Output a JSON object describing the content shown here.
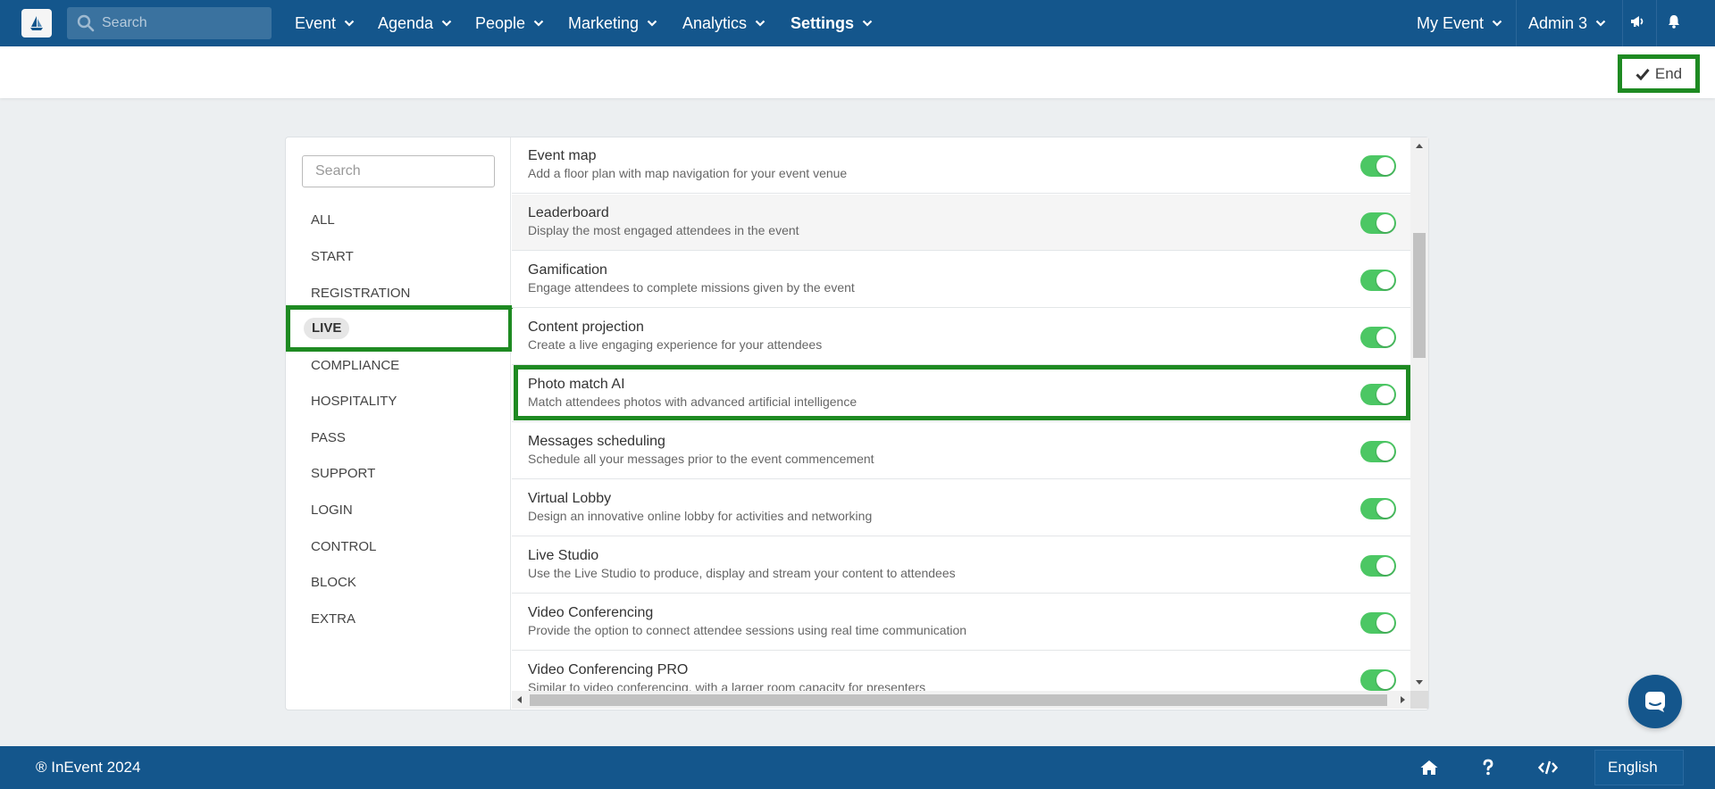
{
  "topnav": {
    "search_placeholder": "Search",
    "menu": [
      {
        "label": "Event"
      },
      {
        "label": "Agenda"
      },
      {
        "label": "People"
      },
      {
        "label": "Marketing"
      },
      {
        "label": "Analytics"
      },
      {
        "label": "Settings"
      }
    ],
    "event_selector": "My Event",
    "user_menu": "Admin 3"
  },
  "subbar": {
    "end_button": "End"
  },
  "tools": {
    "search_placeholder": "Search",
    "categories": [
      {
        "label": "ALL"
      },
      {
        "label": "START"
      },
      {
        "label": "REGISTRATION"
      },
      {
        "label": "LIVE",
        "active": true
      },
      {
        "label": "COMPLIANCE"
      },
      {
        "label": "HOSPITALITY"
      },
      {
        "label": "PASS"
      },
      {
        "label": "SUPPORT"
      },
      {
        "label": "LOGIN"
      },
      {
        "label": "CONTROL"
      },
      {
        "label": "BLOCK"
      },
      {
        "label": "EXTRA"
      }
    ],
    "features": [
      {
        "title": "Event map",
        "description": "Add a floor plan with map navigation for your event venue",
        "enabled": true
      },
      {
        "title": "Leaderboard",
        "description": "Display the most engaged attendees in the event",
        "enabled": true
      },
      {
        "title": "Gamification",
        "description": "Engage attendees to complete missions given by the event",
        "enabled": true
      },
      {
        "title": "Content projection",
        "description": "Create a live engaging experience for your attendees",
        "enabled": true
      },
      {
        "title": "Photo match AI",
        "description": "Match attendees photos with advanced artificial intelligence",
        "enabled": true
      },
      {
        "title": "Messages scheduling",
        "description": "Schedule all your messages prior to the event commencement",
        "enabled": true
      },
      {
        "title": "Virtual Lobby",
        "description": "Design an innovative online lobby for activities and networking",
        "enabled": true
      },
      {
        "title": "Live Studio",
        "description": "Use the Live Studio to produce, display and stream your content to attendees",
        "enabled": true
      },
      {
        "title": "Video Conferencing",
        "description": "Provide the option to connect attendee sessions using real time communication",
        "enabled": true
      },
      {
        "title": "Video Conferencing PRO",
        "description": "Similar to video conferencing, with a larger room capacity for presenters",
        "enabled": true
      }
    ]
  },
  "footer": {
    "copyright": "® InEvent 2024",
    "language": "English"
  },
  "colors": {
    "brand": "#14568c",
    "toggle_on": "#4cc764",
    "highlight": "#1e8a22"
  }
}
